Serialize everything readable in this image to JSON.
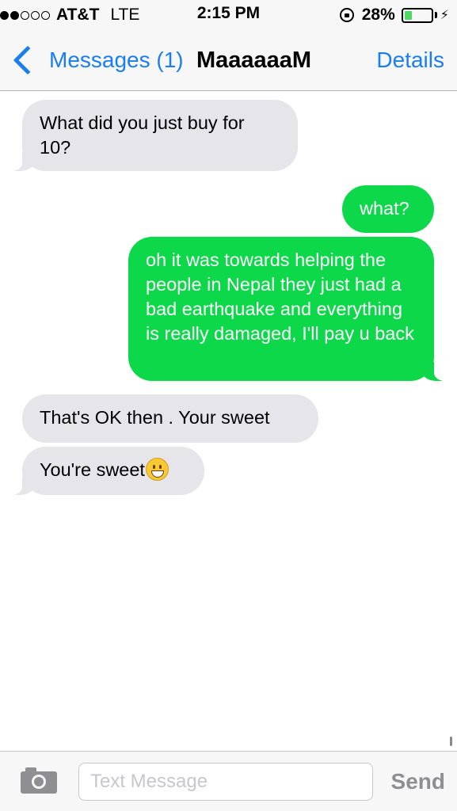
{
  "status_bar": {
    "signal_bars_filled": 2,
    "signal_bars_total": 5,
    "carrier": "AT&T",
    "network": "LTE",
    "time": "2:15 PM",
    "battery_percent": "28%",
    "battery_level": 0.28,
    "icons": [
      "rotation-lock-icon",
      "battery-icon",
      "charging-bolt-icon"
    ]
  },
  "nav": {
    "back_label": "Messages (1)",
    "title": "MaaaaaaM",
    "details_label": "Details"
  },
  "messages": [
    {
      "direction": "incoming",
      "text": "What did you just buy for 10?"
    },
    {
      "direction": "outgoing",
      "text": "what?"
    },
    {
      "direction": "outgoing",
      "text": "oh it was towards helping the people in Nepal they just had a bad earthquake and everything is really damaged, I'll pay u back"
    },
    {
      "direction": "incoming",
      "text": "That's OK then . Your sweet"
    },
    {
      "direction": "incoming",
      "text": "You're sweet",
      "emoji": "grinning-face-emoji"
    }
  ],
  "input_bar": {
    "placeholder": "Text Message",
    "value": "",
    "send_label": "Send",
    "camera_icon": "camera-icon"
  },
  "colors": {
    "accent": "#1a7df0",
    "outgoing_bubble": "#0cd84a",
    "incoming_bubble": "#e5e5ea",
    "battery_fill": "#4cd964"
  }
}
